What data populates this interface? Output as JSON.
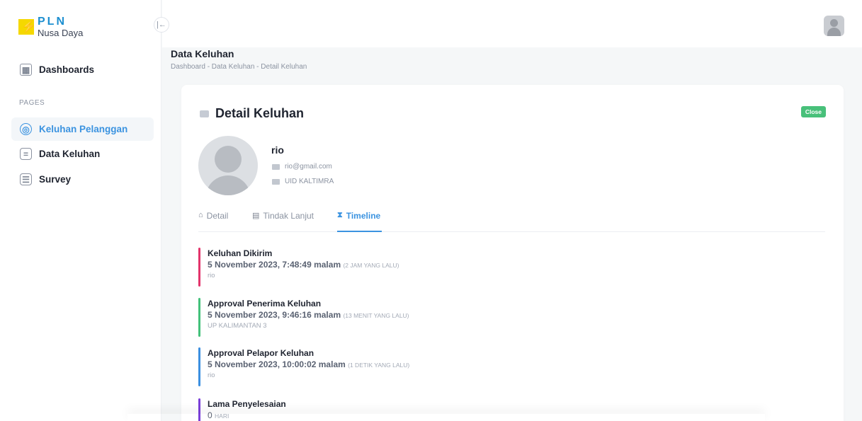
{
  "brand": {
    "name": "PLN",
    "subtitle": "Nusa Daya",
    "bolt": "⚡"
  },
  "sidebar": {
    "dashboards_label": "Dashboards",
    "section_label": "PAGES",
    "items": [
      {
        "label": "Keluhan Pelanggan",
        "icon": "support-icon",
        "active": true
      },
      {
        "label": "Data Keluhan",
        "icon": "clipboard-icon",
        "active": false
      },
      {
        "label": "Survey",
        "icon": "list-icon",
        "active": false
      }
    ]
  },
  "header": {
    "title": "Data Keluhan",
    "breadcrumb": "Dashboard - Data Keluhan - Detail Keluhan"
  },
  "card": {
    "title": "Detail Keluhan",
    "close_label": "Close"
  },
  "profile": {
    "name": "rio",
    "email": "rio@gmail.com",
    "unit": "UID KALTIMRA"
  },
  "tabs": [
    {
      "label": "Detail",
      "active": false
    },
    {
      "label": "Tindak Lanjut",
      "active": false
    },
    {
      "label": "Timeline",
      "active": true
    }
  ],
  "timeline": [
    {
      "title": "Keluhan Dikirim",
      "date": "5 November 2023, 7:48:49 malam",
      "ago": "(2 JAM YANG LALU)",
      "by": "rio",
      "color": "#e3346b"
    },
    {
      "title": "Approval Penerima Keluhan",
      "date": "5 November 2023, 9:46:16 malam",
      "ago": "(13 MENIT YANG LALU)",
      "by": "UP KALIMANTAN 3",
      "color": "#43c17a"
    },
    {
      "title": "Approval Pelapor Keluhan",
      "date": "5 November 2023, 10:00:02 malam",
      "ago": "(1 DETIK YANG LALU)",
      "by": "rio",
      "color": "#3b8fe0"
    },
    {
      "title": "Lama Penyelesaian",
      "date": "0",
      "unit": "HARI",
      "color": "#7a3fd9"
    }
  ]
}
